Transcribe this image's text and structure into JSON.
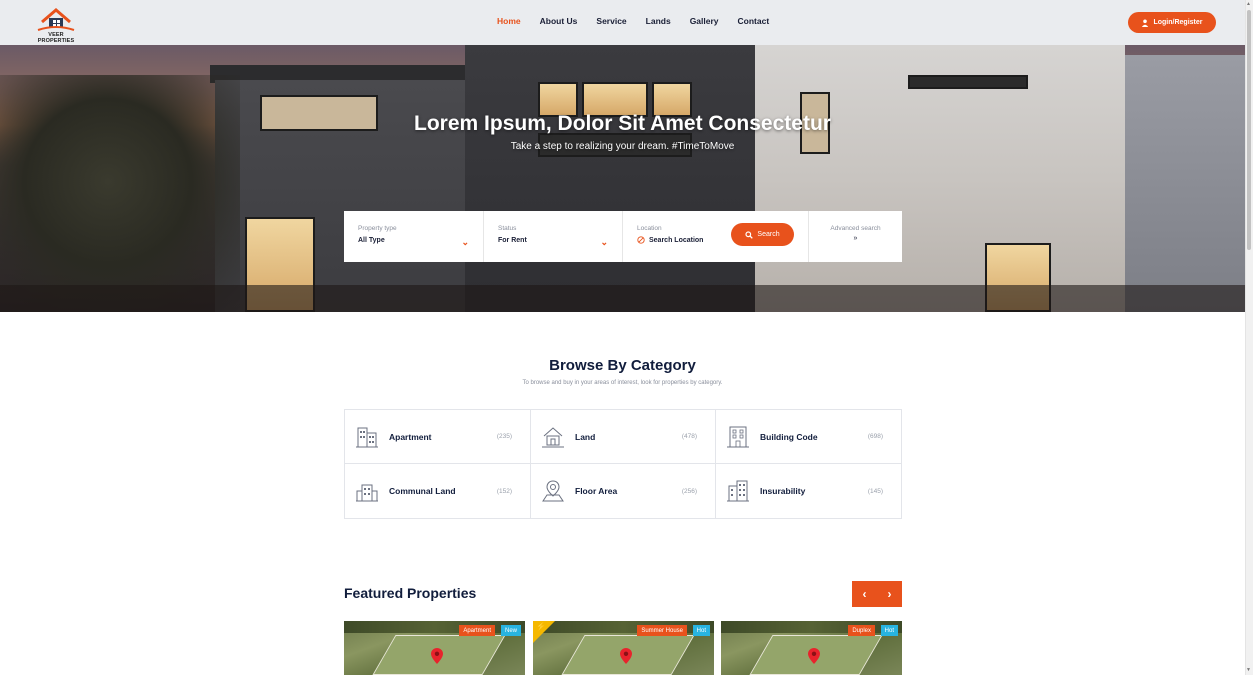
{
  "brand": {
    "name": "VEER PROPERTIES",
    "accent": "#e8521c",
    "dark": "#111d3c"
  },
  "nav": {
    "items": [
      {
        "label": "Home",
        "active": true
      },
      {
        "label": "About Us",
        "active": false
      },
      {
        "label": "Service",
        "active": false
      },
      {
        "label": "Lands",
        "active": false
      },
      {
        "label": "Gallery",
        "active": false
      },
      {
        "label": "Contact",
        "active": false
      }
    ],
    "login_label": "Login/Register",
    "login_icon": "user-icon"
  },
  "hero": {
    "title": "Lorem Ipsum, Dolor Sit Amet Consectetur",
    "subtitle": "Take a step to realizing your dream. #TimeToMove"
  },
  "search": {
    "property_type": {
      "label": "Property type",
      "value": "All Type"
    },
    "status": {
      "label": "Status",
      "value": "For Rent"
    },
    "location": {
      "label": "Location",
      "value": "Search Location",
      "icon": "location-target-icon"
    },
    "search_label": "Search",
    "search_icon": "search-icon",
    "advanced_label": "Advanced search",
    "advanced_icon": "double-chevron-down-icon"
  },
  "browse": {
    "title": "Browse By Category",
    "subtitle": "To browse and buy in your areas of interest, look for properties by category.",
    "categories": [
      {
        "name": "Apartment",
        "count": "(235)",
        "icon": "apartment-icon"
      },
      {
        "name": "Land",
        "count": "(478)",
        "icon": "house-land-icon"
      },
      {
        "name": "Building Code",
        "count": "(698)",
        "icon": "building-icon"
      },
      {
        "name": "Communal Land",
        "count": "(152)",
        "icon": "communal-building-icon"
      },
      {
        "name": "Floor Area",
        "count": "(256)",
        "icon": "floor-area-pin-icon"
      },
      {
        "name": "Insurability",
        "count": "(145)",
        "icon": "office-building-icon"
      }
    ]
  },
  "featured": {
    "title": "Featured Properties",
    "prev_icon": "chevron-left-icon",
    "next_icon": "chevron-right-icon",
    "cards": [
      {
        "type": "Apartment",
        "flag": "New",
        "featured": false
      },
      {
        "type": "Summer House",
        "flag": "Hot",
        "featured": true
      },
      {
        "type": "Duplex",
        "flag": "Hot",
        "featured": false
      }
    ]
  }
}
